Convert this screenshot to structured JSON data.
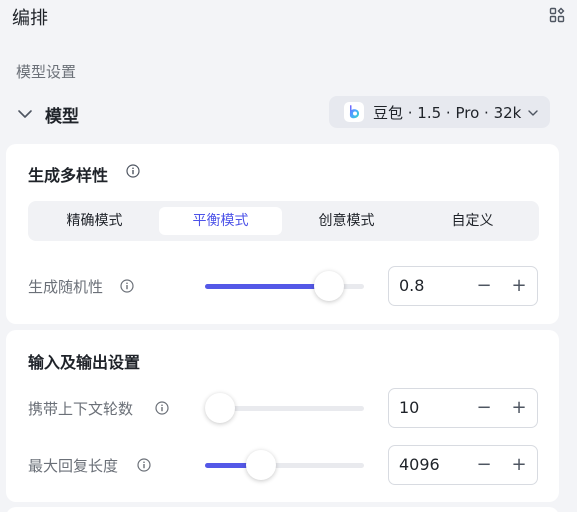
{
  "header": {
    "title": "编排",
    "layout_icon": "grid-layout-icon"
  },
  "section_label": "模型设置",
  "model": {
    "label": "模型",
    "selected": "豆包 · 1.5 · Pro · 32k",
    "logo_icon": "doubao-logo-icon"
  },
  "diversity": {
    "title": "生成多样性",
    "modes": [
      "精确模式",
      "平衡模式",
      "创意模式",
      "自定义"
    ],
    "active_mode": "平衡模式",
    "randomness": {
      "label": "生成随机性",
      "value": "0.8",
      "level": 0.8
    }
  },
  "io": {
    "title": "输入及输出设置",
    "context_rounds": {
      "label": "携带上下文轮数",
      "value": "10",
      "level": 0.0
    },
    "max_length": {
      "label": "最大回复长度",
      "value": "4096",
      "level": 0.34
    }
  },
  "stepper": {
    "minus": "−",
    "plus": "+"
  },
  "colors": {
    "accent": "#4d53e8",
    "slider_fill": "#5458e7",
    "background": "#f3f4f7"
  }
}
